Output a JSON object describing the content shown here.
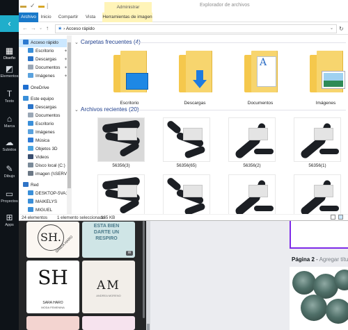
{
  "rail": {
    "back_glyph": "‹",
    "items": [
      {
        "label": "Diseño",
        "icon": "layout-icon"
      },
      {
        "label": "Elementos",
        "icon": "shapes-icon"
      },
      {
        "label": "Texto",
        "icon": "text-icon"
      },
      {
        "label": "Marca",
        "icon": "brand-icon"
      },
      {
        "label": "Subidos",
        "icon": "upload-cloud-icon"
      },
      {
        "label": "Dibujo",
        "icon": "pen-icon"
      },
      {
        "label": "Proyectos",
        "icon": "folder-icon"
      },
      {
        "label": "Apps",
        "icon": "apps-grid-icon"
      }
    ]
  },
  "templates": {
    "t1_mono": "SH.",
    "t1_arc": "SANDA HARO",
    "t2_text": "ESTA BIEN DARTE UN RESPIRO",
    "t2_badge": "W",
    "t3_big": "SH",
    "t3_caption": "SARA HARO",
    "t3_caption2": "MODA FEMENINA",
    "t4_big": "AM",
    "t4_caption": "ANDREA MORENO"
  },
  "canvas": {
    "page2_label": "Página 2",
    "page2_sep": " - ",
    "page2_placeholder": "Agregar título"
  },
  "explorer": {
    "window_title": "Explorador de archivos",
    "context_tab_group": "Administrar",
    "ribbon_tabs": [
      "Archivo",
      "Inicio",
      "Compartir",
      "Vista",
      "Herramientas de imagen"
    ],
    "address": "Acceso rápido",
    "nav_pane": [
      {
        "label": "Acceso rápido",
        "icon": "star-icon",
        "color": "#2b79d0",
        "indent": 1,
        "pinned": false,
        "selected": true
      },
      {
        "label": "Escritorio",
        "icon": "desktop-icon",
        "color": "#3a8fd9",
        "indent": 2,
        "pinned": true,
        "selected": false
      },
      {
        "label": "Descargas",
        "icon": "download-icon",
        "color": "#2a74c9",
        "indent": 2,
        "pinned": true,
        "selected": false
      },
      {
        "label": "Documentos",
        "icon": "documents-icon",
        "color": "#9aa7b6",
        "indent": 2,
        "pinned": true,
        "selected": false
      },
      {
        "label": "Imágenes",
        "icon": "pictures-icon",
        "color": "#5aa2de",
        "indent": 2,
        "pinned": true,
        "selected": false
      },
      {
        "label": "OneDrive",
        "icon": "cloud-icon",
        "color": "#1f6fd0",
        "indent": 1,
        "pinned": false,
        "selected": false
      },
      {
        "label": "Este equipo",
        "icon": "computer-icon",
        "color": "#3a8fd9",
        "indent": 1,
        "pinned": false,
        "selected": false
      },
      {
        "label": "Descargas",
        "icon": "download-icon",
        "color": "#2a74c9",
        "indent": 2,
        "pinned": false,
        "selected": false
      },
      {
        "label": "Documentos",
        "icon": "documents-icon",
        "color": "#9aa7b6",
        "indent": 2,
        "pinned": false,
        "selected": false
      },
      {
        "label": "Escritorio",
        "icon": "desktop-icon",
        "color": "#3a8fd9",
        "indent": 2,
        "pinned": false,
        "selected": false
      },
      {
        "label": "Imágenes",
        "icon": "pictures-icon",
        "color": "#5aa2de",
        "indent": 2,
        "pinned": false,
        "selected": false
      },
      {
        "label": "Música",
        "icon": "music-icon",
        "color": "#2e7bd6",
        "indent": 2,
        "pinned": false,
        "selected": false
      },
      {
        "label": "Objetos 3D",
        "icon": "cube-icon",
        "color": "#4aa3e0",
        "indent": 2,
        "pinned": false,
        "selected": false
      },
      {
        "label": "Videos",
        "icon": "video-icon",
        "color": "#3a4f70",
        "indent": 2,
        "pinned": false,
        "selected": false
      },
      {
        "label": "Disco local (C:)",
        "icon": "drive-icon",
        "color": "#7a8a99",
        "indent": 2,
        "pinned": false,
        "selected": false
      },
      {
        "label": "imagen (\\\\SERVI",
        "icon": "network-drive-icon",
        "color": "#6b7785",
        "indent": 2,
        "pinned": false,
        "selected": false
      },
      {
        "label": "Red",
        "icon": "network-icon",
        "color": "#2f74c6",
        "indent": 1,
        "pinned": false,
        "selected": false
      },
      {
        "label": "DESKTOP-5VA13",
        "icon": "computer-icon",
        "color": "#3a8fd9",
        "indent": 2,
        "pinned": false,
        "selected": false
      },
      {
        "label": "MAIKELYS",
        "icon": "computer-icon",
        "color": "#3a8fd9",
        "indent": 2,
        "pinned": false,
        "selected": false
      },
      {
        "label": "MIGUEL",
        "icon": "computer-icon",
        "color": "#3a8fd9",
        "indent": 2,
        "pinned": false,
        "selected": false
      }
    ],
    "frequent_header": "Carpetas frecuentes (4)",
    "frequent": [
      {
        "name": "Escritorio",
        "decal": "desktop"
      },
      {
        "name": "Descargas",
        "decal": "download"
      },
      {
        "name": "Documentos",
        "decal": "document"
      },
      {
        "name": "Imágenes",
        "decal": "picture"
      }
    ],
    "recent_header": "Archivos recientes (20)",
    "recent": [
      {
        "name": "56356(3)",
        "selected": true
      },
      {
        "name": "56356(65)",
        "selected": false
      },
      {
        "name": "56356(2)",
        "selected": false
      },
      {
        "name": "56356(1)",
        "selected": false
      },
      {
        "name": "",
        "selected": false
      },
      {
        "name": "",
        "selected": false
      },
      {
        "name": "",
        "selected": false
      },
      {
        "name": "",
        "selected": false
      }
    ],
    "status": {
      "count": "24 elementos",
      "selection": "1 elemento seleccionado",
      "size": "165 KB"
    }
  }
}
